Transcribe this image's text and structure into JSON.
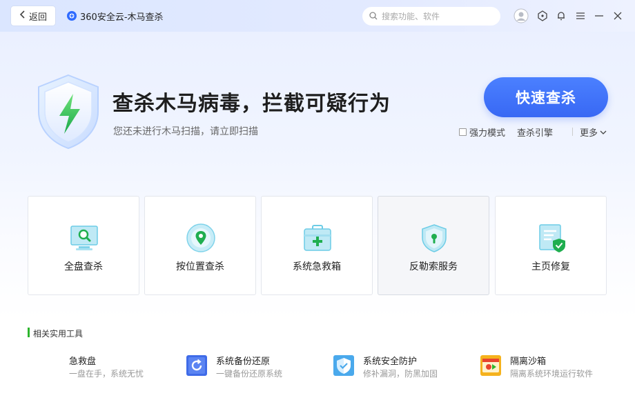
{
  "header": {
    "back_label": "返回",
    "app_title": "360安全云-木马查杀",
    "search_placeholder": "搜索功能、软件"
  },
  "hero": {
    "title": "查杀木马病毒，拦截可疑行为",
    "subtitle": "您还未进行木马扫描，请立即扫描",
    "scan_button": "快速查杀",
    "options": {
      "strong_mode": "强力模式",
      "engine": "查杀引擎",
      "more": "更多"
    }
  },
  "cards": [
    {
      "label": "全盘查杀",
      "icon": "monitor-search-icon"
    },
    {
      "label": "按位置查杀",
      "icon": "location-pin-icon"
    },
    {
      "label": "系统急救箱",
      "icon": "first-aid-kit-icon"
    },
    {
      "label": "反勒索服务",
      "icon": "shield-lock-icon"
    },
    {
      "label": "主页修复",
      "icon": "page-check-icon"
    }
  ],
  "tools_section": {
    "title": "相关实用工具",
    "items": [
      {
        "name": "急救盘",
        "desc": "一盘在手，系统无忧"
      },
      {
        "name": "系统备份还原",
        "desc": "一键备份还原系统"
      },
      {
        "name": "系统安全防护",
        "desc": "修补漏洞，防黑加固"
      },
      {
        "name": "隔离沙箱",
        "desc": "隔离系统环境运行软件"
      }
    ]
  },
  "colors": {
    "accent": "#3868f4",
    "green": "#2db52d"
  }
}
